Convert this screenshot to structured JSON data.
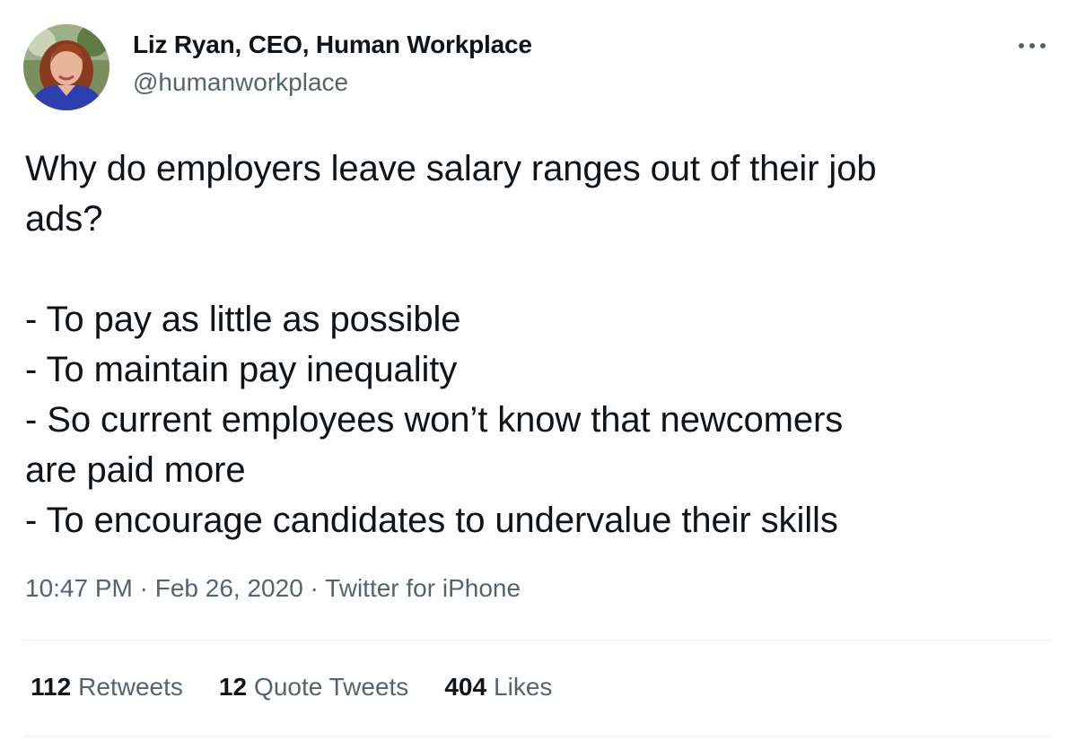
{
  "author": {
    "name": "Liz Ryan, CEO, Human Workplace",
    "handle": "@humanworkplace"
  },
  "tweet": {
    "text": "Why do employers leave salary ranges out of their job\nads?\n\n- To pay as little as possible\n- To maintain pay inequality\n- So current employees won’t know that newcomers\nare paid more\n- To encourage candidates to undervalue their skills"
  },
  "meta": {
    "time": "10:47 PM",
    "sep1": " · ",
    "date": "Feb 26, 2020",
    "sep2": " · ",
    "source": "Twitter for iPhone"
  },
  "stats": {
    "retweets_count": "112",
    "retweets_label": "Retweets",
    "quotes_count": "12",
    "quotes_label": "Quote Tweets",
    "likes_count": "404",
    "likes_label": "Likes"
  },
  "icons": {
    "more": "more-horizontal-icon"
  },
  "colors": {
    "text": "#0f1419",
    "secondary": "#536471",
    "divider": "#e6ecf0"
  }
}
